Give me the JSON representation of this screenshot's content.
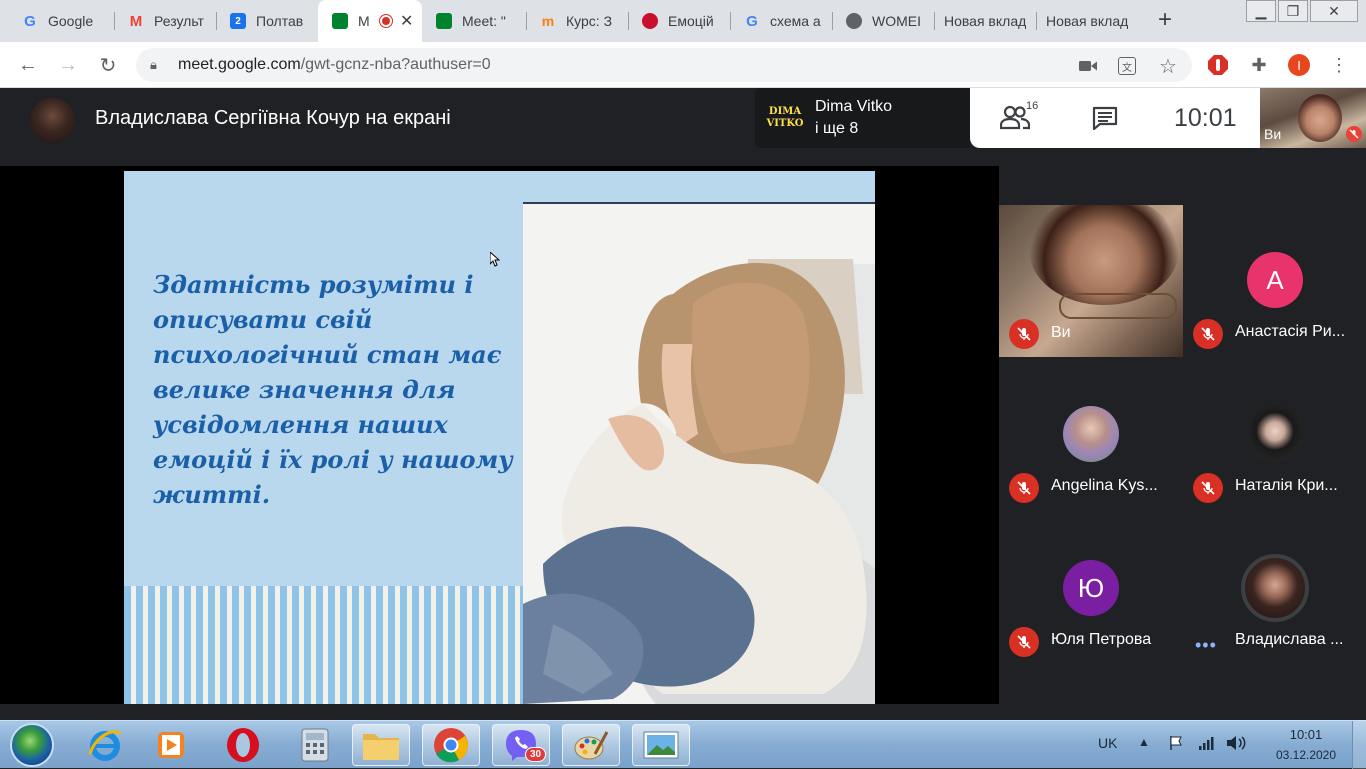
{
  "tabs": [
    {
      "title": "Google",
      "icon": "google-icon",
      "color": "#4285f4"
    },
    {
      "title": "Результ",
      "icon": "gmail-icon",
      "color": "#ea4335"
    },
    {
      "title": "Полтав",
      "icon": "calendar-icon",
      "color": "#1a73e8"
    },
    {
      "title": "M",
      "icon": "meet-icon",
      "color": "#00832d",
      "active": true
    },
    {
      "title": "Meet: \"",
      "icon": "meet-icon",
      "color": "#00832d"
    },
    {
      "title": "Курс: З",
      "icon": "moodle-icon",
      "color": "#f98012"
    },
    {
      "title": "Емоцій",
      "icon": "opera-red-icon",
      "color": "#c8102e"
    },
    {
      "title": "схема а",
      "icon": "google-icon",
      "color": "#4285f4"
    },
    {
      "title": "WOMEI",
      "icon": "globe-icon",
      "color": "#5f6368"
    },
    {
      "title": "Новая вклад",
      "icon": "",
      "color": ""
    },
    {
      "title": "Новая вклад",
      "icon": "",
      "color": ""
    }
  ],
  "address_bar": {
    "url_host": "meet.google.com",
    "url_path": "/gwt-gcnz-nba?authuser=0"
  },
  "profile_initial": "I",
  "meet": {
    "presenter_title": "Владислава Сергіївна Кочур на екрані",
    "speaker": {
      "logo_line1": "DIMA",
      "logo_line2": "VITKO",
      "name": "Dima Vitko",
      "more": "і ще 8"
    },
    "participant_count": "16",
    "time": "10:01",
    "self_label": "Ви"
  },
  "slide": {
    "text": "Здатність розуміти і описувати свій психологічний стан має велике значення для усвідомлення наших емоцій і їх ролі у нашому житті."
  },
  "participants": [
    {
      "name": "Ви",
      "initial": "",
      "avatar_color": "",
      "muted": true,
      "video": true
    },
    {
      "name": "Анастасія Ри...",
      "initial": "A",
      "avatar_color": "#e8336d",
      "muted": true
    },
    {
      "name": "Angelina Kys...",
      "initial": "",
      "avatar_color": "#b79ab8",
      "muted": true,
      "photo": true
    },
    {
      "name": "Наталія Кри...",
      "initial": "",
      "avatar_color": "#2b2b2b",
      "muted": true,
      "photo": true
    },
    {
      "name": "Юля Петрова",
      "initial": "Ю",
      "avatar_color": "#7b1fa2",
      "muted": true
    },
    {
      "name": "Владислава ...",
      "initial": "",
      "avatar_color": "#3a2a26",
      "muted": false,
      "speaking": true,
      "photo": true
    }
  ],
  "taskbar": {
    "apps": [
      "windows-start",
      "internet-explorer",
      "media-player",
      "opera",
      "calculator",
      "explorer",
      "chrome",
      "viber",
      "paint",
      "photo-viewer"
    ],
    "viber_badge": "30",
    "language": "UK",
    "time": "10:01",
    "date": "03.12.2020"
  }
}
